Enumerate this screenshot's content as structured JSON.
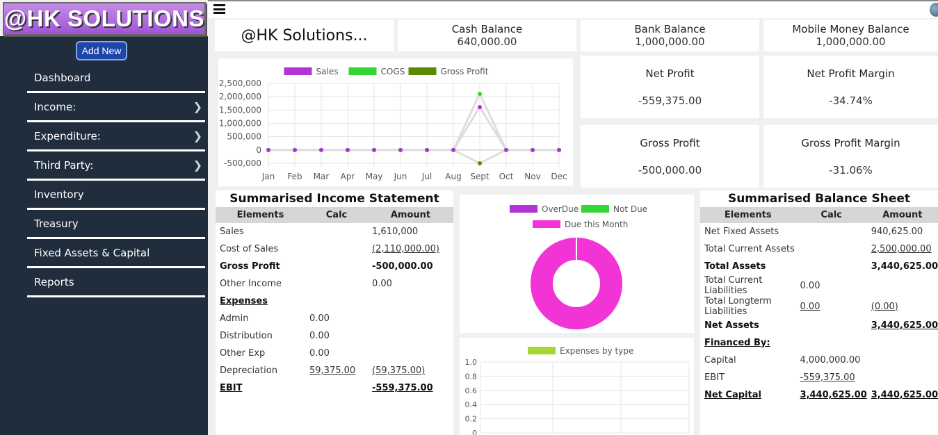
{
  "logo": "@HK SOLUTIONS",
  "add_new": "Add New",
  "nav": [
    {
      "label": "Dashboard",
      "has_sub": false
    },
    {
      "label": "Income:",
      "has_sub": true
    },
    {
      "label": "Expenditure:",
      "has_sub": true
    },
    {
      "label": "Third Party:",
      "has_sub": true
    },
    {
      "label": "Inventory",
      "has_sub": false
    },
    {
      "label": "Treasury",
      "has_sub": false
    },
    {
      "label": "Fixed Assets & Capital",
      "has_sub": false
    },
    {
      "label": "Reports",
      "has_sub": false
    }
  ],
  "company": "@HK Solutions...",
  "kpis": {
    "cash": {
      "title": "Cash Balance",
      "value": "640,000.00"
    },
    "bank": {
      "title": "Bank Balance",
      "value": "1,000,000.00"
    },
    "mobile": {
      "title": "Mobile Money Balance",
      "value": "1,000,000.00"
    },
    "net_profit": {
      "title": "Net Profit",
      "value": "-559,375.00"
    },
    "net_margin": {
      "title": "Net Profit Margin",
      "value": "-34.74%"
    },
    "gross_profit": {
      "title": "Gross Profit",
      "value": "-500,000.00"
    },
    "gross_margin": {
      "title": "Gross Profit Margin",
      "value": "-31.06%"
    }
  },
  "income_statement": {
    "title": "Summarised Income Statement",
    "headers": [
      "Elements",
      "Calc",
      "Amount"
    ],
    "rows": [
      {
        "label": "Sales",
        "calc": "",
        "amount": "1,610,000",
        "style": ""
      },
      {
        "label": "Cost of Sales",
        "calc": "",
        "amount": "(2,110,000.00)",
        "style": "amt-u"
      },
      {
        "label": "Gross Profit",
        "calc": "",
        "amount": "-500,000.00",
        "style": "bold"
      },
      {
        "label": "Other Income",
        "calc": "",
        "amount": "0.00",
        "style": ""
      },
      {
        "label": "Expenses",
        "calc": "",
        "amount": "",
        "style": "head"
      },
      {
        "label": "Admin",
        "calc": "0.00",
        "amount": "",
        "style": ""
      },
      {
        "label": "Distribution",
        "calc": "0.00",
        "amount": "",
        "style": ""
      },
      {
        "label": "Other Exp",
        "calc": "0.00",
        "amount": "",
        "style": ""
      },
      {
        "label": "Depreciation",
        "calc": "59,375.00",
        "amount": "(59,375.00)",
        "style": "both-u"
      },
      {
        "label": "EBIT",
        "calc": "",
        "amount": "-559,375.00",
        "style": "total"
      }
    ]
  },
  "balance_sheet": {
    "title": "Summarised Balance Sheet",
    "headers": [
      "Elements",
      "Calc",
      "Amount"
    ],
    "rows": [
      {
        "label": "Net Fixed Assets",
        "calc": "",
        "amount": "940,625.00",
        "style": ""
      },
      {
        "label": "Total Current Assets",
        "calc": "",
        "amount": "2,500,000.00",
        "style": "amt-u"
      },
      {
        "label": "Total Assets",
        "calc": "",
        "amount": "3,440,625.00",
        "style": "bold"
      },
      {
        "label": "Total Current Liabilities",
        "calc": "0.00",
        "amount": "",
        "style": ""
      },
      {
        "label": "Total Longterm Liabilities",
        "calc": "0.00",
        "amount": "(0.00)",
        "style": "both-u"
      },
      {
        "label": "Net Assets",
        "calc": "",
        "amount": "3,440,625.00",
        "style": "bold-amt-u"
      },
      {
        "label": "Financed By:",
        "calc": "",
        "amount": "",
        "style": "head"
      },
      {
        "label": "Capital",
        "calc": "4,000,000.00",
        "amount": "",
        "style": ""
      },
      {
        "label": "EBIT",
        "calc": "-559,375.00",
        "amount": "",
        "style": "calc-u"
      },
      {
        "label": "Net Capital",
        "calc": "3,440,625.00",
        "amount": "3,440,625.00",
        "style": "total-all"
      }
    ]
  },
  "chart_data": [
    {
      "type": "line",
      "legend": [
        "Sales",
        "COGS",
        "Gross Profit"
      ],
      "colors": [
        "#b233d6",
        "#33d633",
        "#5a8a00"
      ],
      "categories": [
        "Jan",
        "Feb",
        "Mar",
        "Apr",
        "May",
        "Jun",
        "Jul",
        "Aug",
        "Sept",
        "Oct",
        "Nov",
        "Dec"
      ],
      "series": [
        {
          "name": "Sales",
          "values": [
            0,
            0,
            0,
            0,
            0,
            0,
            0,
            0,
            1610000,
            0,
            0,
            0
          ]
        },
        {
          "name": "COGS",
          "values": [
            0,
            0,
            0,
            0,
            0,
            0,
            0,
            0,
            2110000,
            0,
            0,
            0
          ]
        },
        {
          "name": "Gross Profit",
          "values": [
            0,
            0,
            0,
            0,
            0,
            0,
            0,
            0,
            -500000,
            0,
            0,
            0
          ]
        }
      ],
      "yticks": [
        "2,500,000",
        "2,000,000",
        "1,500,000",
        "1,000,000",
        "500,000",
        "0",
        "-500,000"
      ],
      "ylim": [
        -500000,
        2500000
      ]
    },
    {
      "type": "pie",
      "legend": [
        "OverDue",
        "Not Due",
        "Due this Month"
      ],
      "colors": [
        "#b233d6",
        "#33d633",
        "#f233d6"
      ],
      "values": [
        0,
        0,
        100
      ]
    },
    {
      "type": "bar",
      "legend": [
        "Expenses by type"
      ],
      "colors": [
        "#a6d633"
      ],
      "yticks": [
        "1.0",
        "0.8",
        "0.6",
        "0.4",
        "0.2",
        "0"
      ],
      "ylim": [
        0,
        1
      ],
      "values": []
    }
  ]
}
